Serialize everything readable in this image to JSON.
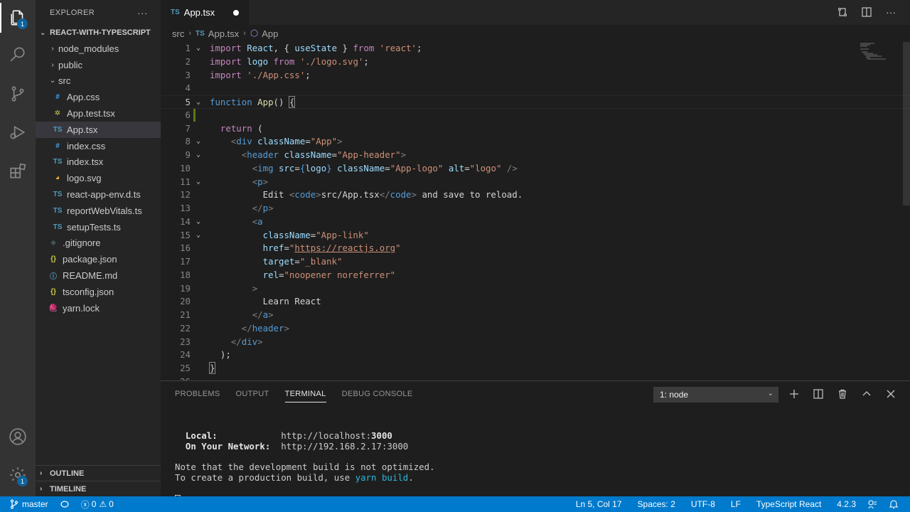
{
  "activity_bar": {
    "explorer_badge": "1",
    "settings_badge": "1"
  },
  "sidebar": {
    "title": "EXPLORER",
    "more_label": "···",
    "project": "REACT-WITH-TYPESCRIPT",
    "tree": [
      {
        "label": "node_modules",
        "kind": "folder",
        "chev": "›",
        "indent": 1
      },
      {
        "label": "public",
        "kind": "folder",
        "chev": "›",
        "indent": 1
      },
      {
        "label": "src",
        "kind": "folder",
        "chev": "⌄",
        "indent": 1
      },
      {
        "label": "App.css",
        "kind": "css",
        "icon": "#",
        "indent": 2
      },
      {
        "label": "App.test.tsx",
        "kind": "test",
        "icon": "✲",
        "indent": 2
      },
      {
        "label": "App.tsx",
        "kind": "ts",
        "icon": "TS",
        "indent": 2,
        "selected": true
      },
      {
        "label": "index.css",
        "kind": "css",
        "icon": "#",
        "indent": 2
      },
      {
        "label": "index.tsx",
        "kind": "ts",
        "icon": "TS",
        "indent": 2
      },
      {
        "label": "logo.svg",
        "kind": "svg",
        "icon": "◕",
        "indent": 2
      },
      {
        "label": "react-app-env.d.ts",
        "kind": "ts",
        "icon": "TS",
        "indent": 2
      },
      {
        "label": "reportWebVitals.ts",
        "kind": "ts",
        "icon": "TS",
        "indent": 2
      },
      {
        "label": "setupTests.ts",
        "kind": "ts",
        "icon": "TS",
        "indent": 2
      },
      {
        "label": ".gitignore",
        "kind": "git",
        "icon": "◆",
        "indent": 1
      },
      {
        "label": "package.json",
        "kind": "json",
        "icon": "{}",
        "indent": 1
      },
      {
        "label": "README.md",
        "kind": "md",
        "icon": "ⓘ",
        "indent": 1
      },
      {
        "label": "tsconfig.json",
        "kind": "json",
        "icon": "{}",
        "indent": 1
      },
      {
        "label": "yarn.lock",
        "kind": "yarn",
        "icon": "🧶",
        "indent": 1
      }
    ],
    "outline": "OUTLINE",
    "timeline": "TIMELINE"
  },
  "tab": {
    "lang": "TS",
    "name": "App.tsx"
  },
  "breadcrumb": {
    "folder": "src",
    "lang": "TS",
    "file": "App.tsx",
    "symbol": "App"
  },
  "editor": {
    "lines": [
      {
        "n": "1",
        "fold": "⌄",
        "html": "<span class='kw'>import</span> <span class='var'>React</span>, { <span class='var'>useState</span> } <span class='kw'>from</span> <span class='str'>'react'</span>;"
      },
      {
        "n": "2",
        "fold": "",
        "html": "<span class='kw'>import</span> <span class='var'>logo</span> <span class='kw'>from</span> <span class='str'>'./logo.svg'</span>;"
      },
      {
        "n": "3",
        "fold": "",
        "html": "<span class='kw'>import</span> <span class='str'>'./App.css'</span>;"
      },
      {
        "n": "4",
        "fold": "",
        "html": ""
      },
      {
        "n": "5",
        "fold": "⌄",
        "html": "<span class='kb'>function</span> <span class='fn'>App</span>() <span class='brace-hl'>{</span>",
        "current": true
      },
      {
        "n": "6",
        "fold": "",
        "html": "",
        "modified": true
      },
      {
        "n": "7",
        "fold": "",
        "html": "  <span class='kw'>return</span> ("
      },
      {
        "n": "8",
        "fold": "⌄",
        "html": "    <span class='punct'>&lt;</span><span class='tag'>div</span> <span class='attr'>className</span>=<span class='str'>\"App\"</span><span class='punct'>&gt;</span>"
      },
      {
        "n": "9",
        "fold": "⌄",
        "html": "      <span class='punct'>&lt;</span><span class='tag'>header</span> <span class='attr'>className</span>=<span class='str'>\"App-header\"</span><span class='punct'>&gt;</span>"
      },
      {
        "n": "10",
        "fold": "",
        "html": "        <span class='punct'>&lt;</span><span class='tag'>img</span> <span class='attr'>src</span>=<span class='kb'>{</span><span class='var'>logo</span><span class='kb'>}</span> <span class='attr'>className</span>=<span class='str'>\"App-logo\"</span> <span class='attr'>alt</span>=<span class='str'>\"logo\"</span> <span class='punct'>/&gt;</span>"
      },
      {
        "n": "11",
        "fold": "⌄",
        "html": "        <span class='punct'>&lt;</span><span class='tag'>p</span><span class='punct'>&gt;</span>"
      },
      {
        "n": "12",
        "fold": "",
        "html": "          Edit <span class='punct'>&lt;</span><span class='tag'>code</span><span class='punct'>&gt;</span>src/App.tsx<span class='punct'>&lt;/</span><span class='tag'>code</span><span class='punct'>&gt;</span> and save to reload."
      },
      {
        "n": "13",
        "fold": "",
        "html": "        <span class='punct'>&lt;/</span><span class='tag'>p</span><span class='punct'>&gt;</span>"
      },
      {
        "n": "14",
        "fold": "⌄",
        "html": "        <span class='punct'>&lt;</span><span class='tag'>a</span>"
      },
      {
        "n": "15",
        "fold": "⌄",
        "html": "          <span class='attr'>className</span>=<span class='str'>\"App-link\"</span>"
      },
      {
        "n": "16",
        "fold": "",
        "html": "          <span class='attr'>href</span>=<span class='str'>\"</span><span class='link'>https://reactjs.org</span><span class='str'>\"</span>"
      },
      {
        "n": "17",
        "fold": "",
        "html": "          <span class='attr'>target</span>=<span class='str'>\"_blank\"</span>"
      },
      {
        "n": "18",
        "fold": "",
        "html": "          <span class='attr'>rel</span>=<span class='str'>\"noopener noreferrer\"</span>"
      },
      {
        "n": "19",
        "fold": "",
        "html": "        <span class='punct'>&gt;</span>"
      },
      {
        "n": "20",
        "fold": "",
        "html": "          Learn React"
      },
      {
        "n": "21",
        "fold": "",
        "html": "        <span class='punct'>&lt;/</span><span class='tag'>a</span><span class='punct'>&gt;</span>"
      },
      {
        "n": "22",
        "fold": "",
        "html": "      <span class='punct'>&lt;/</span><span class='tag'>header</span><span class='punct'>&gt;</span>"
      },
      {
        "n": "23",
        "fold": "",
        "html": "    <span class='punct'>&lt;/</span><span class='tag'>div</span><span class='punct'>&gt;</span>"
      },
      {
        "n": "24",
        "fold": "",
        "html": "  );"
      },
      {
        "n": "25",
        "fold": "",
        "html": "<span class='brace-hl'>}</span>"
      },
      {
        "n": "26",
        "fold": "",
        "html": ""
      }
    ]
  },
  "panel": {
    "tabs": [
      "PROBLEMS",
      "OUTPUT",
      "TERMINAL",
      "DEBUG CONSOLE"
    ],
    "active_tab": "TERMINAL",
    "terminal_select": "1: node"
  },
  "terminal": {
    "local_label": "  Local:",
    "local_url_prefix": "http://localhost:",
    "local_port": "3000",
    "network_label": "  On Your Network:",
    "network_url": "http://192.168.2.17:3000",
    "note_line": "Note that the development build is not optimized.",
    "prod_prefix": "To create a production build, use ",
    "prod_cmd": "yarn build",
    "prod_suffix": "."
  },
  "statusbar": {
    "branch": "master",
    "errors": "0",
    "warnings": "0",
    "position": "Ln 5, Col 17",
    "spaces": "Spaces: 2",
    "encoding": "UTF-8",
    "eol": "LF",
    "language": "TypeScript React",
    "version": "4.2.3"
  },
  "colors": {
    "accent": "#007acc",
    "activity_bar": "#333333",
    "sidebar": "#252526",
    "editor": "#1e1e1e",
    "css_icon": "#42a5f5",
    "ts_icon": "#519aba",
    "json_icon": "#cbcb41",
    "svg_icon": "#ffb13b",
    "md_icon": "#519aba",
    "git_icon": "#41535b",
    "test_icon": "#cbcb41",
    "yarn_icon": "#4a90e2"
  }
}
